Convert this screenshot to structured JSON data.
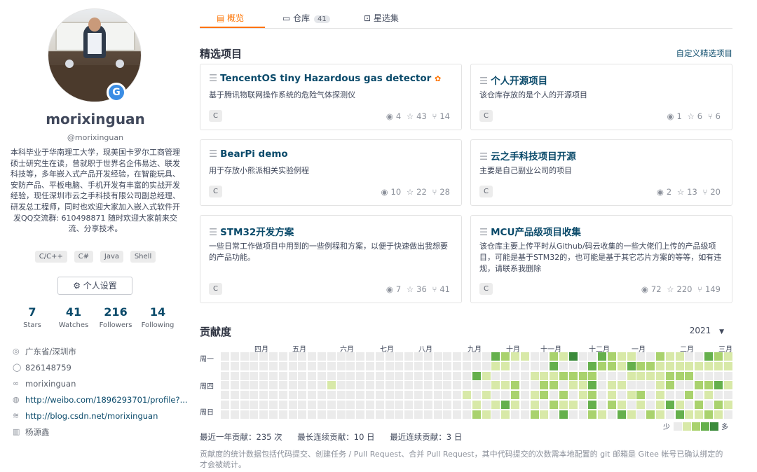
{
  "profile": {
    "name": "morixinguan",
    "handle": "@morixinguan",
    "bio": "本科毕业于华南理工大学，现美国卡罗尔工商管理硕士研究生在读，曾就职于世界名企伟易达、联发科技等，多年嵌入式产品开发经验，在智能玩具、安防产品、平板电脑、手机开发有丰富的实战开发经验，现任深圳市云之手科技有限公司副总经理、研发总工程师，同时也欢迎大家加入嵌入式软件开发QQ交流群: 610498871 随时欢迎大家前来交流、分享技术。",
    "tags": [
      "C/C++",
      "C#",
      "Java",
      "Shell"
    ],
    "settings_label": "个人设置",
    "stats": [
      {
        "num": "7",
        "label": "Stars"
      },
      {
        "num": "41",
        "label": "Watches"
      },
      {
        "num": "216",
        "label": "Followers"
      },
      {
        "num": "14",
        "label": "Following"
      }
    ],
    "location": "广东省/深圳市",
    "qq": "826148759",
    "wechat": "morixinguan",
    "weibo": "http://weibo.com/1896293701/profile?...",
    "blog": "http://blog.csdn.net/morixinguan",
    "company": "杨源鑫"
  },
  "tabs": {
    "overview": "概览",
    "repos": "仓库",
    "repos_count": "41",
    "stars": "星选集"
  },
  "featured": {
    "title": "精选项目",
    "custom_link": "自定义精选项目",
    "cards": [
      {
        "title": "TencentOS tiny Hazardous gas detector",
        "desc": "基于腾讯物联网操作系统的危险气体探测仪",
        "lang": "C",
        "watches": "4",
        "stars": "43",
        "forks": "14",
        "badge": true
      },
      {
        "title": "个人开源项目",
        "desc": "该仓库存放的是个人的开源项目",
        "lang": "C",
        "watches": "1",
        "stars": "6",
        "forks": "6"
      },
      {
        "title": "BearPi demo",
        "desc": "用于存放小熊派相关实验例程",
        "lang": "C",
        "watches": "10",
        "stars": "22",
        "forks": "28"
      },
      {
        "title": "云之手科技项目开源",
        "desc": "主要是自己副业公司的项目",
        "lang": "C",
        "watches": "2",
        "stars": "13",
        "forks": "20"
      },
      {
        "title": "STM32开发方案",
        "desc": "一些日常工作做项目中用到的一些例程和方案，以便于快速做出我想要的产品功能。",
        "lang": "C",
        "watches": "7",
        "stars": "36",
        "forks": "41"
      },
      {
        "title": "MCU产品级项目收集",
        "desc": "该仓库主要上传平时从Github/码云收集的一些大佬们上传的产品级项目，可能是基于STM32的，也可能是基于其它芯片方案的等等，如有违规，请联系我删除",
        "lang": "C",
        "watches": "72",
        "stars": "220",
        "forks": "149"
      }
    ]
  },
  "contributions": {
    "title": "贡献度",
    "year": "2021",
    "months": [
      "四月",
      "五月",
      "六月",
      "七月",
      "八月",
      "九月",
      "十月",
      "十一月",
      "十二月",
      "一月",
      "二月",
      "三月"
    ],
    "day_labels": [
      "周一",
      "周四",
      "周日"
    ],
    "legend_less": "少",
    "legend_more": "多",
    "colors": [
      "#ebebeb",
      "#d8e9a8",
      "#a9d26d",
      "#65b04c",
      "#3a8a3a"
    ],
    "total": "最近一年贡献：235 次",
    "longest": "最长连续贡献：10 日",
    "recent": "最近连续贡献：3 日",
    "note": "贡献度的统计数据包括代码提交、创建任务 / Pull Request、合并 Pull Request，其中代码提交的次数需本地配置的 git 邮箱是 Gitee 帐号已确认绑定的才会被统计。"
  }
}
